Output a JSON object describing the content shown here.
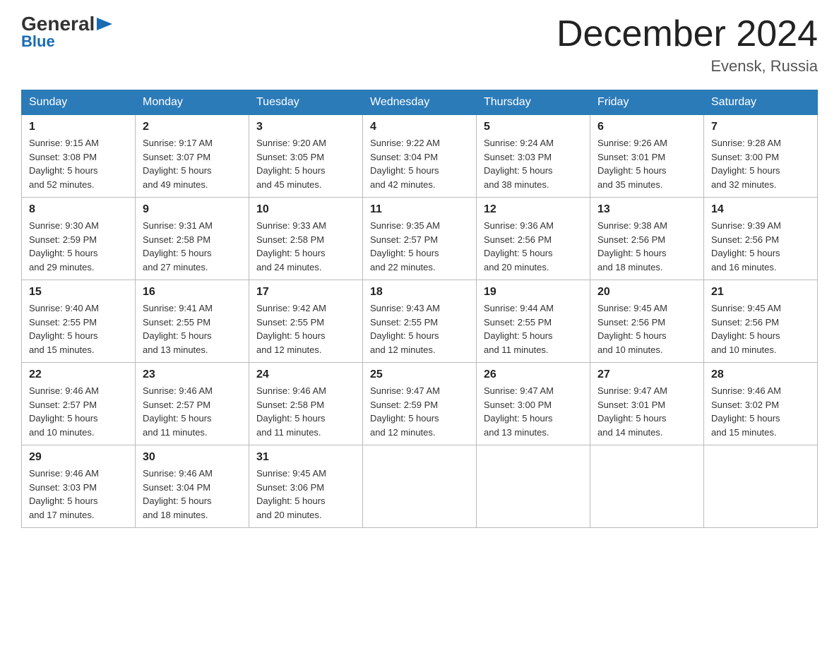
{
  "logo": {
    "general": "General",
    "blue": "Blue",
    "triangle_char": "▶"
  },
  "title": "December 2024",
  "location": "Evensk, Russia",
  "days_of_week": [
    "Sunday",
    "Monday",
    "Tuesday",
    "Wednesday",
    "Thursday",
    "Friday",
    "Saturday"
  ],
  "weeks": [
    [
      {
        "day": "1",
        "info": "Sunrise: 9:15 AM\nSunset: 3:08 PM\nDaylight: 5 hours\nand 52 minutes."
      },
      {
        "day": "2",
        "info": "Sunrise: 9:17 AM\nSunset: 3:07 PM\nDaylight: 5 hours\nand 49 minutes."
      },
      {
        "day": "3",
        "info": "Sunrise: 9:20 AM\nSunset: 3:05 PM\nDaylight: 5 hours\nand 45 minutes."
      },
      {
        "day": "4",
        "info": "Sunrise: 9:22 AM\nSunset: 3:04 PM\nDaylight: 5 hours\nand 42 minutes."
      },
      {
        "day": "5",
        "info": "Sunrise: 9:24 AM\nSunset: 3:03 PM\nDaylight: 5 hours\nand 38 minutes."
      },
      {
        "day": "6",
        "info": "Sunrise: 9:26 AM\nSunset: 3:01 PM\nDaylight: 5 hours\nand 35 minutes."
      },
      {
        "day": "7",
        "info": "Sunrise: 9:28 AM\nSunset: 3:00 PM\nDaylight: 5 hours\nand 32 minutes."
      }
    ],
    [
      {
        "day": "8",
        "info": "Sunrise: 9:30 AM\nSunset: 2:59 PM\nDaylight: 5 hours\nand 29 minutes."
      },
      {
        "day": "9",
        "info": "Sunrise: 9:31 AM\nSunset: 2:58 PM\nDaylight: 5 hours\nand 27 minutes."
      },
      {
        "day": "10",
        "info": "Sunrise: 9:33 AM\nSunset: 2:58 PM\nDaylight: 5 hours\nand 24 minutes."
      },
      {
        "day": "11",
        "info": "Sunrise: 9:35 AM\nSunset: 2:57 PM\nDaylight: 5 hours\nand 22 minutes."
      },
      {
        "day": "12",
        "info": "Sunrise: 9:36 AM\nSunset: 2:56 PM\nDaylight: 5 hours\nand 20 minutes."
      },
      {
        "day": "13",
        "info": "Sunrise: 9:38 AM\nSunset: 2:56 PM\nDaylight: 5 hours\nand 18 minutes."
      },
      {
        "day": "14",
        "info": "Sunrise: 9:39 AM\nSunset: 2:56 PM\nDaylight: 5 hours\nand 16 minutes."
      }
    ],
    [
      {
        "day": "15",
        "info": "Sunrise: 9:40 AM\nSunset: 2:55 PM\nDaylight: 5 hours\nand 15 minutes."
      },
      {
        "day": "16",
        "info": "Sunrise: 9:41 AM\nSunset: 2:55 PM\nDaylight: 5 hours\nand 13 minutes."
      },
      {
        "day": "17",
        "info": "Sunrise: 9:42 AM\nSunset: 2:55 PM\nDaylight: 5 hours\nand 12 minutes."
      },
      {
        "day": "18",
        "info": "Sunrise: 9:43 AM\nSunset: 2:55 PM\nDaylight: 5 hours\nand 12 minutes."
      },
      {
        "day": "19",
        "info": "Sunrise: 9:44 AM\nSunset: 2:55 PM\nDaylight: 5 hours\nand 11 minutes."
      },
      {
        "day": "20",
        "info": "Sunrise: 9:45 AM\nSunset: 2:56 PM\nDaylight: 5 hours\nand 10 minutes."
      },
      {
        "day": "21",
        "info": "Sunrise: 9:45 AM\nSunset: 2:56 PM\nDaylight: 5 hours\nand 10 minutes."
      }
    ],
    [
      {
        "day": "22",
        "info": "Sunrise: 9:46 AM\nSunset: 2:57 PM\nDaylight: 5 hours\nand 10 minutes."
      },
      {
        "day": "23",
        "info": "Sunrise: 9:46 AM\nSunset: 2:57 PM\nDaylight: 5 hours\nand 11 minutes."
      },
      {
        "day": "24",
        "info": "Sunrise: 9:46 AM\nSunset: 2:58 PM\nDaylight: 5 hours\nand 11 minutes."
      },
      {
        "day": "25",
        "info": "Sunrise: 9:47 AM\nSunset: 2:59 PM\nDaylight: 5 hours\nand 12 minutes."
      },
      {
        "day": "26",
        "info": "Sunrise: 9:47 AM\nSunset: 3:00 PM\nDaylight: 5 hours\nand 13 minutes."
      },
      {
        "day": "27",
        "info": "Sunrise: 9:47 AM\nSunset: 3:01 PM\nDaylight: 5 hours\nand 14 minutes."
      },
      {
        "day": "28",
        "info": "Sunrise: 9:46 AM\nSunset: 3:02 PM\nDaylight: 5 hours\nand 15 minutes."
      }
    ],
    [
      {
        "day": "29",
        "info": "Sunrise: 9:46 AM\nSunset: 3:03 PM\nDaylight: 5 hours\nand 17 minutes."
      },
      {
        "day": "30",
        "info": "Sunrise: 9:46 AM\nSunset: 3:04 PM\nDaylight: 5 hours\nand 18 minutes."
      },
      {
        "day": "31",
        "info": "Sunrise: 9:45 AM\nSunset: 3:06 PM\nDaylight: 5 hours\nand 20 minutes."
      },
      {
        "day": "",
        "info": ""
      },
      {
        "day": "",
        "info": ""
      },
      {
        "day": "",
        "info": ""
      },
      {
        "day": "",
        "info": ""
      }
    ]
  ]
}
